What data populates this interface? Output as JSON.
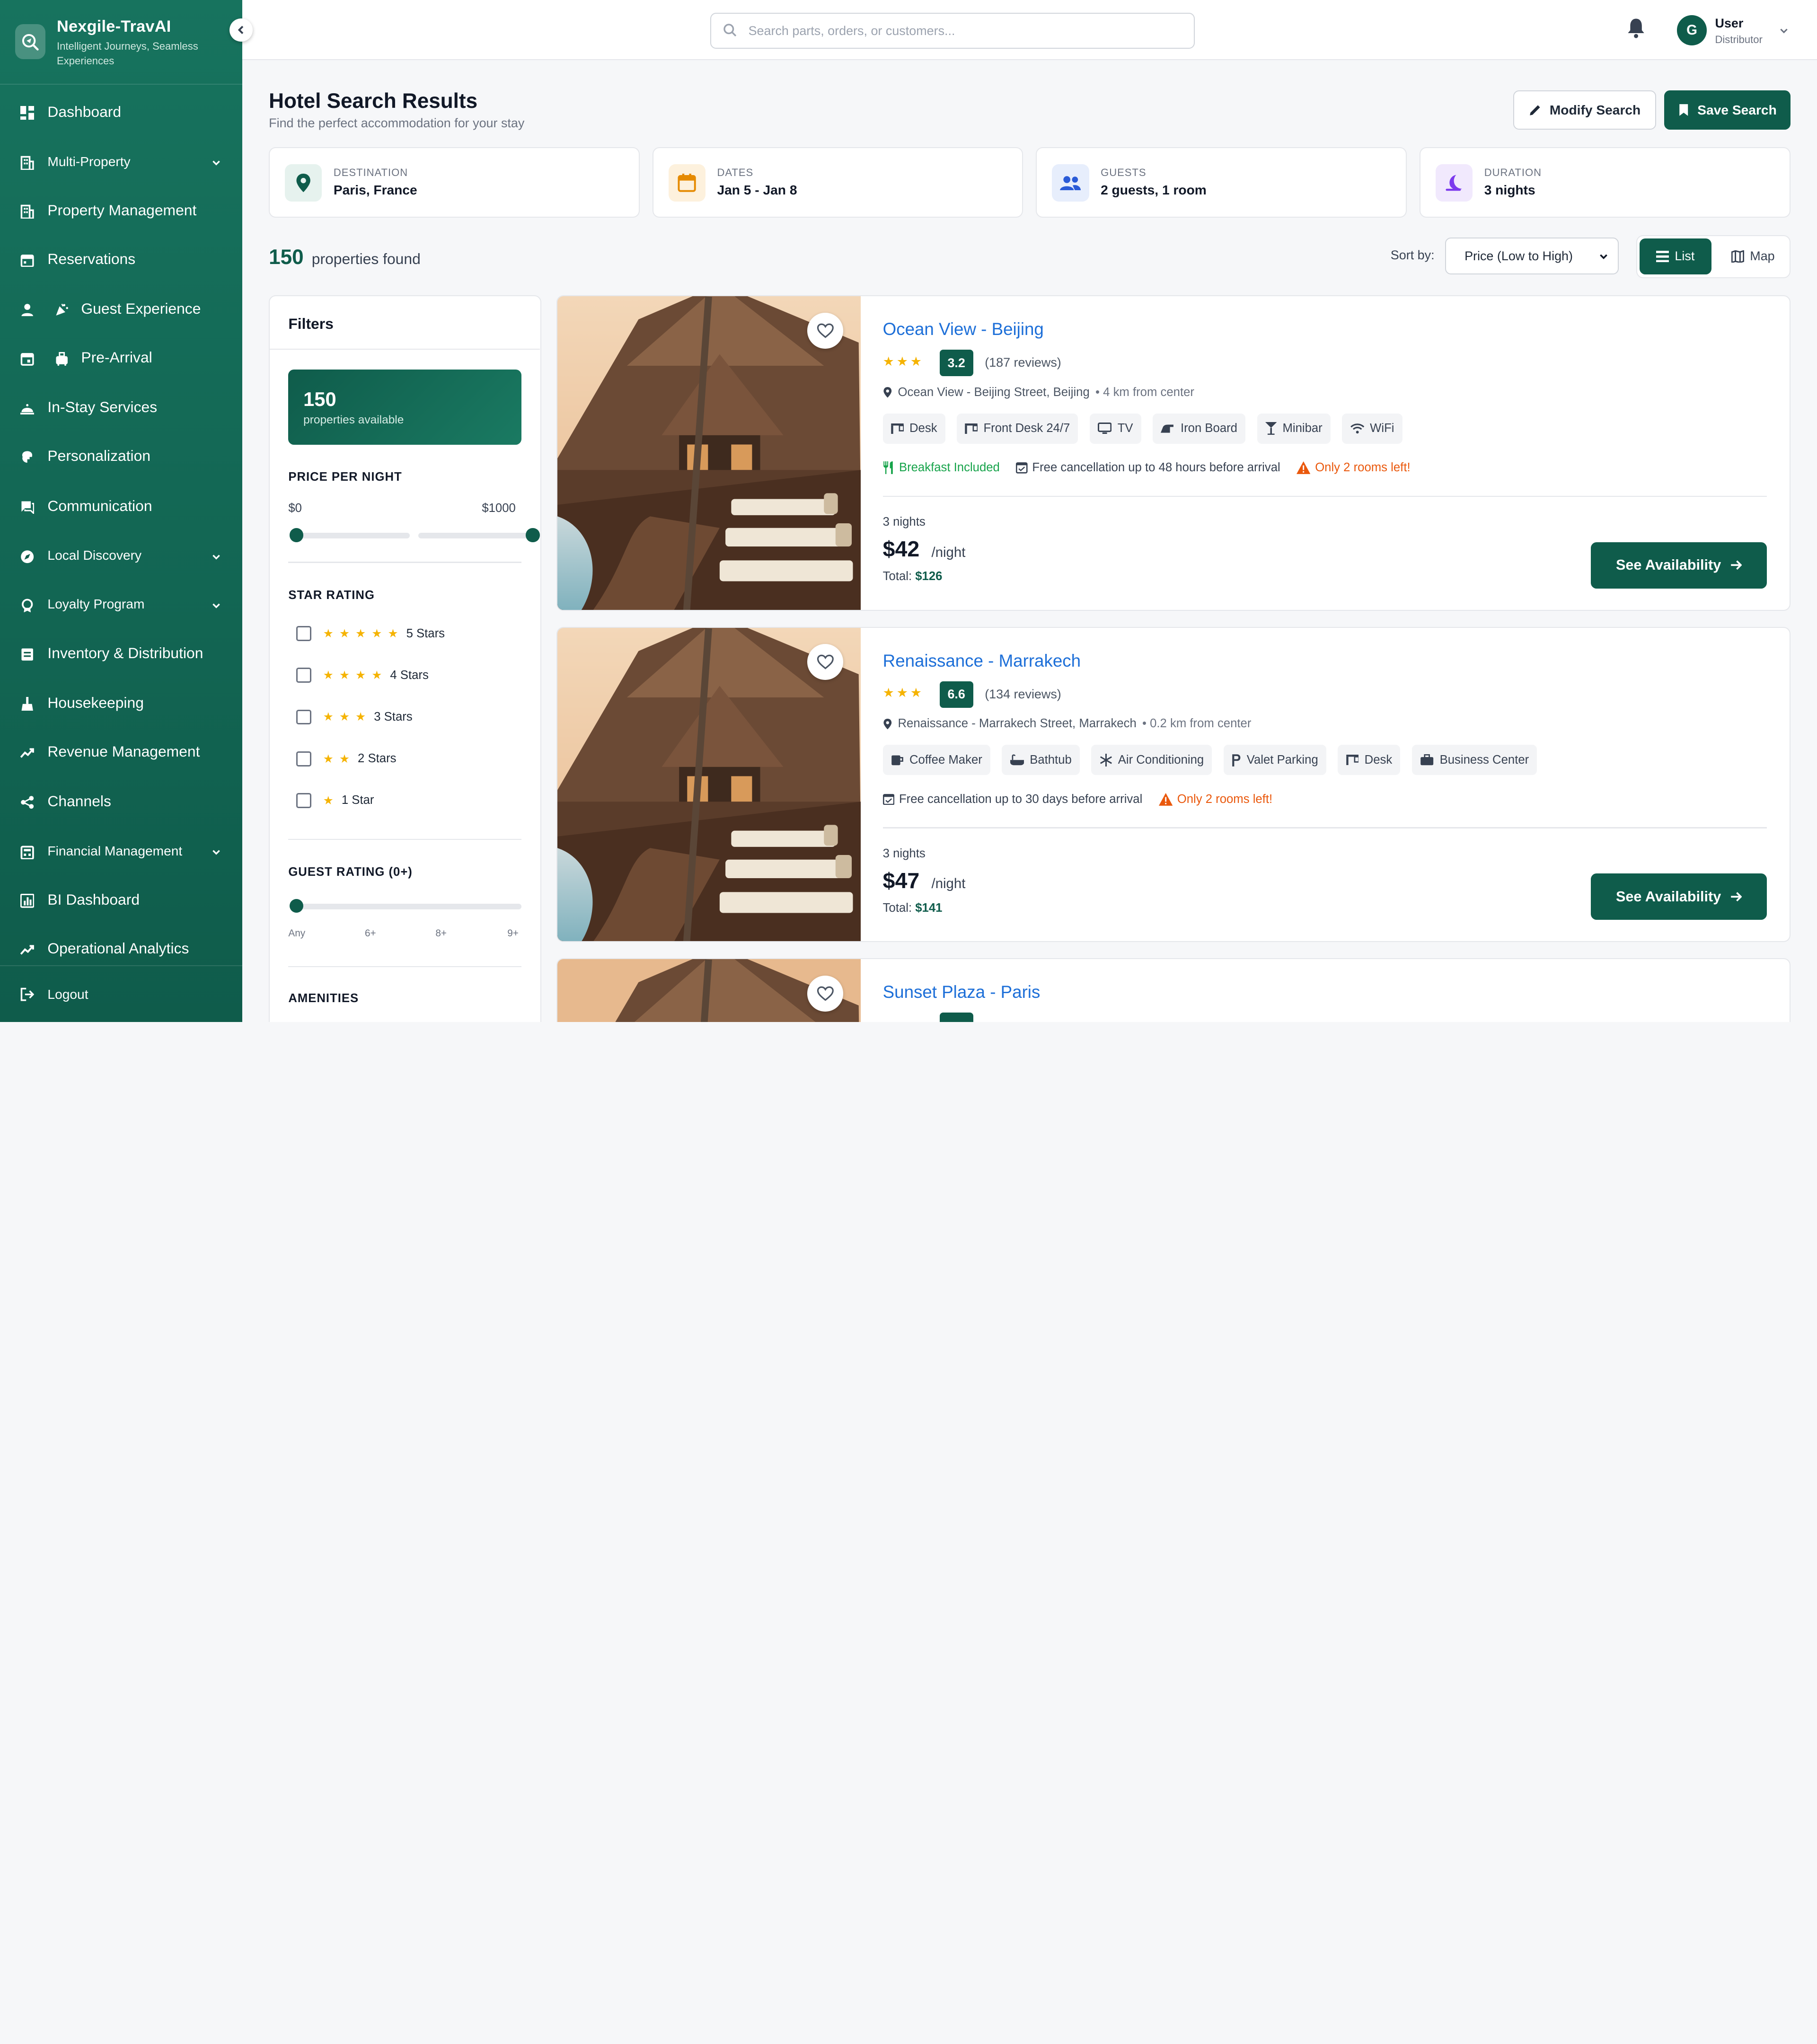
{
  "brand": {
    "name": "Nexgile-TravAI",
    "tagline": "Intelligent Journeys, Seamless Experiences"
  },
  "sidebar": {
    "items": [
      {
        "label": "Dashboard",
        "icon": "grid-icon"
      },
      {
        "label": "Multi-Property",
        "icon": "building-icon",
        "expandable": true
      },
      {
        "label": "Property Management",
        "icon": "building-icon"
      },
      {
        "label": "Reservations",
        "icon": "calendar-icon"
      },
      {
        "label": "Guest Experience",
        "icon": "person-icon",
        "sub_icon": "party-icon"
      },
      {
        "label": "Pre-Arrival",
        "icon": "calendar-icon",
        "sub_icon": "luggage-icon"
      },
      {
        "label": "In-Stay Services",
        "icon": "service-bell-icon"
      },
      {
        "label": "Personalization",
        "icon": "brain-icon"
      },
      {
        "label": "Communication",
        "icon": "chat-icon"
      },
      {
        "label": "Local Discovery",
        "icon": "compass-icon",
        "expandable": true
      },
      {
        "label": "Loyalty Program",
        "icon": "award-icon",
        "expandable": true
      },
      {
        "label": "Inventory & Distribution",
        "icon": "inventory-icon"
      },
      {
        "label": "Housekeeping",
        "icon": "cleaning-icon"
      },
      {
        "label": "Revenue Management",
        "icon": "trend-icon"
      },
      {
        "label": "Channels",
        "icon": "share-icon"
      },
      {
        "label": "Financial Management",
        "icon": "finance-icon",
        "expandable": true
      },
      {
        "label": "BI Dashboard",
        "icon": "bar-chart-icon"
      },
      {
        "label": "Operational Analytics",
        "icon": "trend-icon"
      }
    ],
    "logout": "Logout"
  },
  "topbar": {
    "search_placeholder": "Search parts, orders, or customers...",
    "user": {
      "initial": "G",
      "name": "User",
      "role": "Distributor"
    }
  },
  "header": {
    "title": "Hotel Search Results",
    "subtitle": "Find the perfect accommodation for your stay",
    "modify_label": "Modify Search",
    "save_label": "Save Search"
  },
  "summary": [
    {
      "label": "DESTINATION",
      "value": "Paris, France",
      "icon": "location-pin-icon",
      "color": "#0f5c4b"
    },
    {
      "label": "DATES",
      "value": "Jan 5 - Jan 8",
      "icon": "calendar-icon",
      "color": "#e58a00"
    },
    {
      "label": "GUESTS",
      "value": "2 guests, 1 room",
      "icon": "people-icon",
      "color": "#2a5bd7"
    },
    {
      "label": "DURATION",
      "value": "3 nights",
      "icon": "moon-icon",
      "color": "#7c3aed"
    }
  ],
  "results": {
    "count": "150",
    "count_label": "properties found"
  },
  "sort": {
    "label": "Sort by:",
    "value": "Price (Low to High)"
  },
  "view": {
    "list_label": "List",
    "map_label": "Map",
    "active": "list"
  },
  "filters": {
    "title": "Filters",
    "available_count": "150",
    "available_label": "properties available",
    "price_title": "PRICE PER NIGHT",
    "price_min": "$0",
    "price_max": "$1000",
    "star_title": "STAR RATING",
    "star_options": [
      {
        "label": "5 Stars",
        "stars": "★★★★★"
      },
      {
        "label": "4 Stars",
        "stars": "★★★★"
      },
      {
        "label": "3 Stars",
        "stars": "★★★"
      },
      {
        "label": "2 Stars",
        "stars": "★★"
      },
      {
        "label": "1 Star",
        "stars": "★"
      }
    ],
    "guest_rating_title": "GUEST RATING (0+)",
    "guest_rating_ticks": [
      "Any",
      "6+",
      "8+",
      "9+"
    ],
    "amenities_title": "AMENITIES"
  },
  "hotels": [
    {
      "name": "Ocean View - Beijing",
      "stars": "★★★",
      "score": "3.2",
      "reviews": "(187 reviews)",
      "address": "Ocean View - Beijing Street, Beijing",
      "distance": "• 4 km from center",
      "amenities": [
        {
          "label": "Desk",
          "icon": "desk-icon"
        },
        {
          "label": "Front Desk 24/7",
          "icon": "desk-icon"
        },
        {
          "label": "TV",
          "icon": "tv-icon"
        },
        {
          "label": "Iron Board",
          "icon": "iron-icon"
        },
        {
          "label": "Minibar",
          "icon": "cocktail-icon"
        },
        {
          "label": "WiFi",
          "icon": "wifi-icon"
        }
      ],
      "breakfast": "Breakfast Included",
      "cancellation": "Free cancellation up to 48 hours before arrival",
      "scarcity": "Only 2 rooms left!",
      "nights": "3 nights",
      "price": "$42",
      "per": "/night",
      "total_label": "Total:",
      "total": "$126",
      "cta": "See Availability"
    },
    {
      "name": "Renaissance - Marrakech",
      "stars": "★★★",
      "score": "6.6",
      "reviews": "(134 reviews)",
      "address": "Renaissance - Marrakech Street, Marrakech",
      "distance": "• 0.2 km from center",
      "amenities": [
        {
          "label": "Coffee Maker",
          "icon": "coffee-icon"
        },
        {
          "label": "Bathtub",
          "icon": "bathtub-icon"
        },
        {
          "label": "Air Conditioning",
          "icon": "snowflake-icon"
        },
        {
          "label": "Valet Parking",
          "icon": "parking-icon"
        },
        {
          "label": "Desk",
          "icon": "desk-icon"
        },
        {
          "label": "Business Center",
          "icon": "briefcase-icon"
        }
      ],
      "cancellation": "Free cancellation up to 30 days before arrival",
      "scarcity": "Only 2 rooms left!",
      "nights": "3 nights",
      "price": "$47",
      "per": "/night",
      "total_label": "Total:",
      "total": "$141",
      "cta": "See Availability"
    },
    {
      "name": "Sunset Plaza - Paris"
    }
  ],
  "colors": {
    "primary": "#0f5c4b",
    "link": "#1d6fd8",
    "star": "#f5b301",
    "breakfast": "#16a34a",
    "warning": "#ea580c"
  }
}
